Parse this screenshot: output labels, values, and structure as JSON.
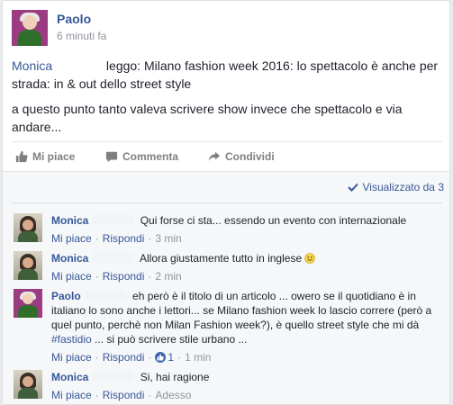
{
  "post": {
    "author": "Paolo",
    "time": "6 minuti fa",
    "mention": "Monica",
    "line1_rest": "leggo: Milano fashion week 2016: lo spettacolo è anche per strada: in & out dello street style",
    "line2": "a questo punto tanto valeva scrivere show invece che spettacolo e via andare..."
  },
  "actions": {
    "like": "Mi piace",
    "comment": "Commenta",
    "share": "Condividi"
  },
  "seen": "Visualizzato da 3",
  "comments": [
    {
      "author": "Monica",
      "text": "Qui forse ci sta... essendo un evento con internazionale",
      "like": "Mi piace",
      "reply": "Rispondi",
      "time": "3 min"
    },
    {
      "author": "Monica",
      "text": "Allora giustamente tutto in inglese",
      "like": "Mi piace",
      "reply": "Rispondi",
      "time": "2 min"
    },
    {
      "author": "Paolo",
      "text_before": "eh però è il titolo di un articolo ... owero se il quotidiano è in italiano lo sono anche i lettori... se Milano fashion week lo lascio correre (però a quel punto, perchè non Milan Fashion week?), è quello street style che mi dà",
      "hashtag": "#fastidio",
      "text_after": "... si può scrivere stile urbano ...",
      "like": "Mi piace",
      "reply": "Rispondi",
      "like_count": "1",
      "time": "1 min"
    },
    {
      "author": "Monica",
      "text": "Si, hai ragione",
      "like": "Mi piace",
      "reply": "Rispondi",
      "time": "Adesso"
    }
  ],
  "colors": {
    "link": "#365899",
    "text": "#1d2129",
    "muted": "#90949c",
    "comments_bg": "#f6f7f9"
  }
}
